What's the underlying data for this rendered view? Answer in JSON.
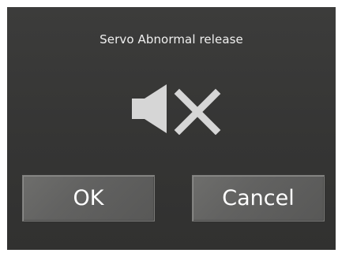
{
  "dialog": {
    "title": "Servo Abnormal release",
    "icon": "speaker-muted-icon",
    "ok_label": "OK",
    "cancel_label": "Cancel"
  },
  "colors": {
    "dialog_background": "#363635",
    "button_background": "#666665",
    "icon_color": "#d6d6d6",
    "text_color": "#ffffff"
  }
}
